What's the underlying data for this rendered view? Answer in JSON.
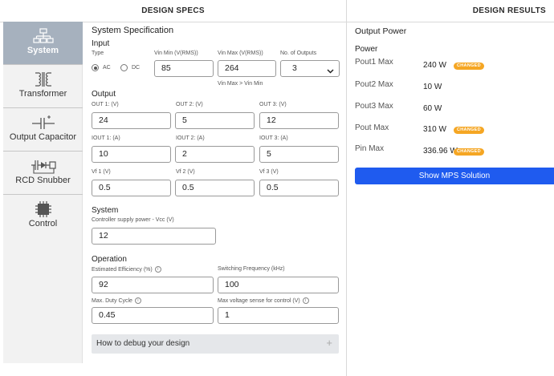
{
  "header": {
    "specs_title": "DESIGN SPECS",
    "results_title": "DESIGN RESULTS"
  },
  "sidebar": {
    "items": [
      {
        "label": "System",
        "icon": "system-tree-icon",
        "active": true
      },
      {
        "label": "Transformer",
        "icon": "transformer-icon",
        "active": false
      },
      {
        "label": "Output Capacitor",
        "icon": "capacitor-icon",
        "active": false
      },
      {
        "label": "RCD Snubber",
        "icon": "snubber-icon",
        "active": false
      },
      {
        "label": "Control",
        "icon": "chip-icon",
        "active": false
      }
    ]
  },
  "spec": {
    "title": "System Specification",
    "input": {
      "title": "Input",
      "type_label": "Type",
      "type_options": [
        "AC",
        "DC"
      ],
      "type_selected": "AC",
      "vin_min_label": "Vin Min (V(RMS))",
      "vin_min_value": "85",
      "vin_max_label": "Vin Max (V(RMS))",
      "vin_max_value": "264",
      "vin_note": "Vin Max > Vin Min",
      "outputs_label": "No. of Outputs",
      "outputs_value": "3"
    },
    "output": {
      "title": "Output",
      "out_labels": [
        "OUT 1: (V)",
        "OUT 2: (V)",
        "OUT 3: (V)"
      ],
      "out_values": [
        "24",
        "5",
        "12"
      ],
      "iout_labels": [
        "IOUT 1: (A)",
        "IOUT 2: (A)",
        "IOUT 3: (A)"
      ],
      "iout_values": [
        "10",
        "2",
        "5"
      ],
      "vf_labels": [
        "Vf 1 (V)",
        "Vf 2 (V)",
        "Vf 3 (V)"
      ],
      "vf_values": [
        "0.5",
        "0.5",
        "0.5"
      ]
    },
    "system": {
      "title": "System",
      "vcc_label": "Controller supply power - Vcc (V)",
      "vcc_value": "12"
    },
    "operation": {
      "title": "Operation",
      "eff_label": "Estimated Efficiency (%)",
      "eff_value": "92",
      "freq_label": "Switching Frequency (kHz)",
      "freq_value": "100",
      "duty_label": "Max. Duty Cycle",
      "duty_value": "0.45",
      "vsense_label": "Max voltage sense for control (V)",
      "vsense_value": "1"
    },
    "debug_label": "How to debug your design"
  },
  "results": {
    "title": "Output Power",
    "power_title": "Power",
    "rows": [
      {
        "label": "Pout1 Max",
        "value": "240 W",
        "badge": "CHANGED"
      },
      {
        "label": "Pout2 Max",
        "value": "10 W",
        "badge": ""
      },
      {
        "label": "Pout3 Max",
        "value": "60 W",
        "badge": ""
      },
      {
        "label": "Pout Max",
        "value": "310 W",
        "badge": "CHANGED"
      },
      {
        "label": "Pin Max",
        "value": "336.96 W",
        "badge": "CHANGED"
      }
    ],
    "button_label": "Show MPS Solution"
  },
  "colors": {
    "accent": "#1f5bef",
    "badge": "#f5a623",
    "sidebar_active": "#a6b1be"
  }
}
